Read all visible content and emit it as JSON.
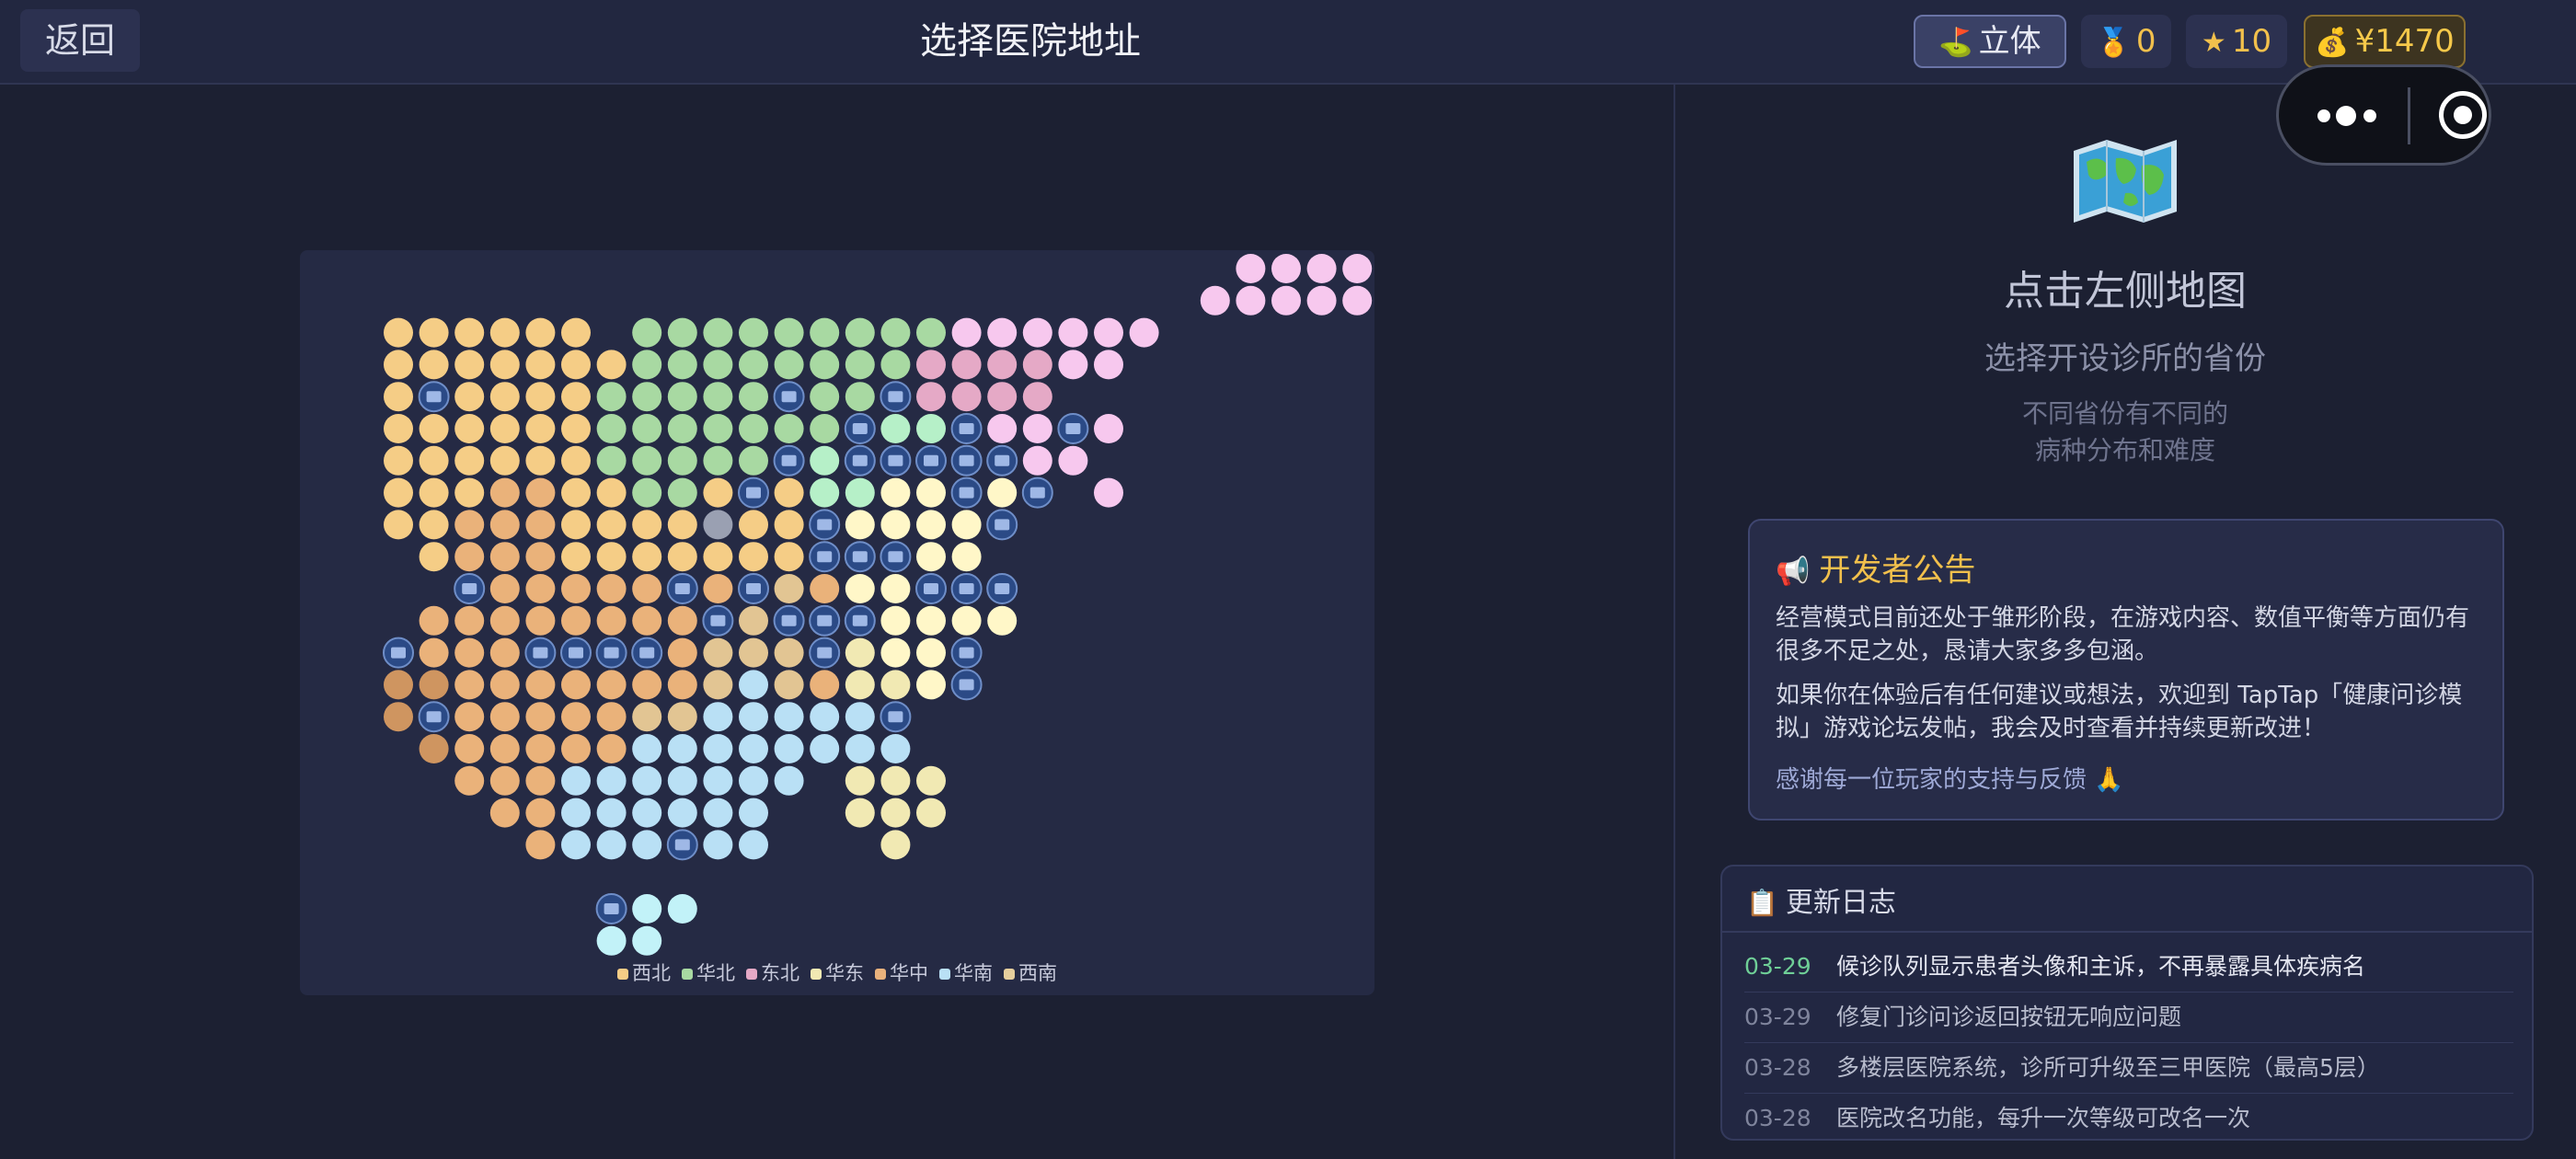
{
  "header": {
    "back_label": "返回",
    "title": "选择医院地址",
    "view_mode_icon": "hospital-flag-icon",
    "view_mode_label": "立体",
    "medal_icon": "medal-icon",
    "medal_count": "0",
    "star_icon": "star-icon",
    "star_count": "10",
    "money_icon": "money-bag-icon",
    "money": "¥1470"
  },
  "map": {
    "legend": [
      {
        "name": "西北",
        "color": "#f5cd86"
      },
      {
        "name": "华北",
        "color": "#a8d9a2"
      },
      {
        "name": "东北",
        "color": "#e5a9c6"
      },
      {
        "name": "华东",
        "color": "#f1e9b3"
      },
      {
        "name": "华中",
        "color": "#e9b27c"
      },
      {
        "name": "华南",
        "color": "#b9e0f5"
      },
      {
        "name": "西南",
        "color": "#e6cf9d"
      }
    ]
  },
  "hint": {
    "icon": "world-map-icon",
    "title": "点击左侧地图",
    "subtitle": "选择开设诊所的省份",
    "desc_line1": "不同省份有不同的",
    "desc_line2": "病种分布和难度"
  },
  "notice": {
    "icon": "megaphone-icon",
    "title": "开发者公告",
    "p1": "经营模式目前还处于雏形阶段，在游戏内容、数值平衡等方面仍有很多不足之处，恳请大家多多包涵。",
    "p2": "如果你在体验后有任何建议或想法，欢迎到 TapTap「健康问诊模拟」游戏论坛发帖，我会及时查看并持续更新改进！",
    "p3": "感谢每一位玩家的支持与反馈 🙏"
  },
  "changelog": {
    "icon": "clipboard-icon",
    "title": "更新日志",
    "entries": [
      {
        "date": "03-29",
        "text": "候诊队列显示患者头像和主诉，不再暴露具体疾病名"
      },
      {
        "date": "03-29",
        "text": "修复门诊问诊返回按钮无响应问题"
      },
      {
        "date": "03-28",
        "text": "多楼层医院系统，诊所可升级至三甲医院（最高5层）"
      },
      {
        "date": "03-28",
        "text": "医院改名功能，每升一次等级可改名一次"
      }
    ]
  },
  "colors": {
    "background": "#1c2032",
    "accent_gold": "#f2c04c",
    "hospital_marker": "#2b4a86"
  }
}
